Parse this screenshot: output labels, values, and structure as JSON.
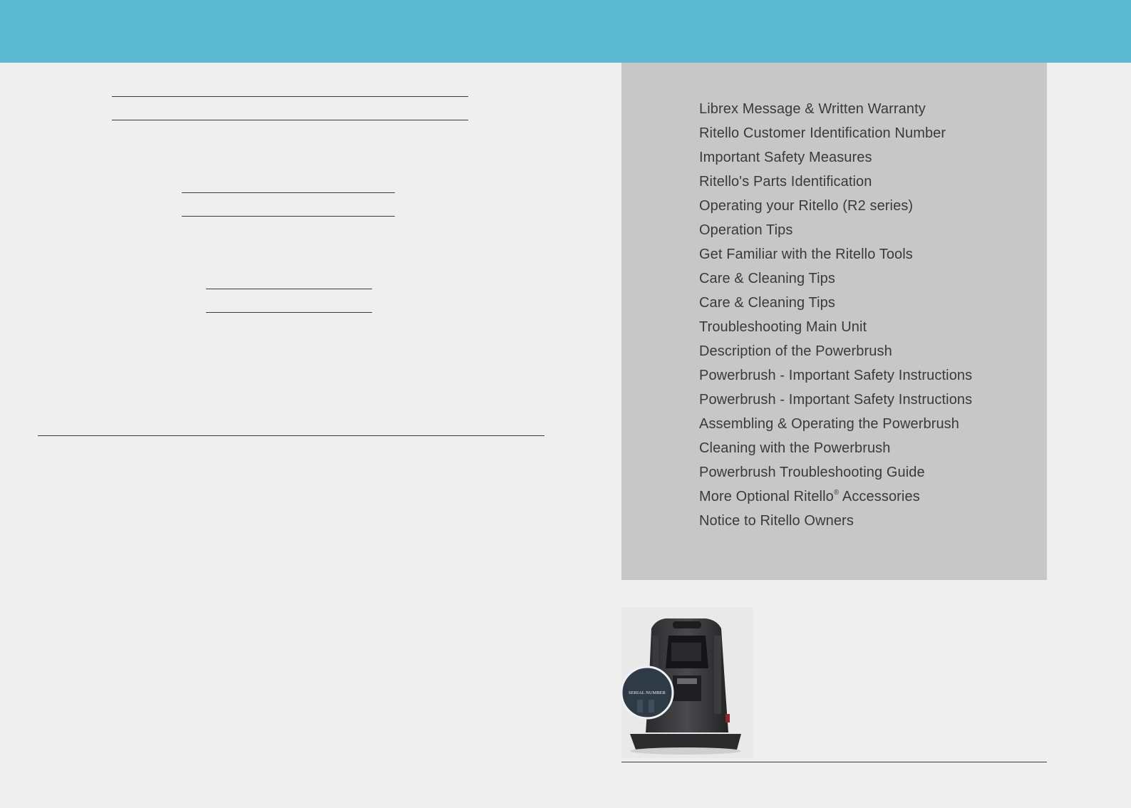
{
  "toc": {
    "items": [
      {
        "label": "Librex Message & Written Warranty"
      },
      {
        "label": "Ritello Customer Identification Number"
      },
      {
        "label": "Important Safety Measures"
      },
      {
        "label": "Ritello's Parts Identification"
      },
      {
        "label": "Operating your Ritello (R2 series)"
      },
      {
        "label": "Operation Tips"
      },
      {
        "label": "Get Familiar with the Ritello Tools"
      },
      {
        "label": "Care & Cleaning Tips"
      },
      {
        "label": "Care & Cleaning Tips"
      },
      {
        "label": "Troubleshooting Main Unit"
      },
      {
        "label": "Description of the Powerbrush"
      },
      {
        "label": "Powerbrush - Important Safety Instructions"
      },
      {
        "label": "Powerbrush - Important Safety Instructions"
      },
      {
        "label": "Assembling & Operating the Powerbrush"
      },
      {
        "label": "Cleaning with the Powerbrush"
      },
      {
        "label": "Powerbrush Troubleshooting Guide"
      },
      {
        "label": "More Optional Ritello",
        "mark": "®",
        "suffix": " Accessories"
      },
      {
        "label": "Notice to Ritello Owners"
      }
    ]
  },
  "product_photo": {
    "badge_label": "SERIAL NUMBER"
  },
  "colors": {
    "banner": "#5bbad1",
    "page_background": "#efefef",
    "toc_panel": "#c7c7c7",
    "text": "#3a3a3a"
  }
}
